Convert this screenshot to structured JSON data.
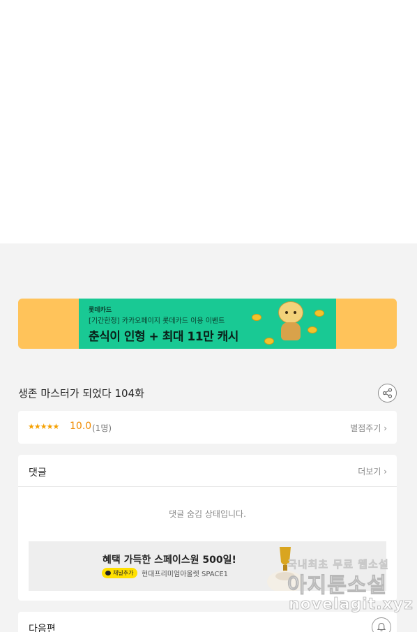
{
  "banner": {
    "brand": "롯데카드",
    "subtitle": "[기간한정] 카카오페이지 롯데카드 이용 이벤트",
    "title": "춘식이 인형 + 최대 11만 캐시",
    "bg_color": "#ffc35a",
    "accent_color": "#19c994"
  },
  "episode": {
    "title": "생존 마스터가 되었다 104화"
  },
  "rating": {
    "stars": "★★★★★",
    "value": "10.0",
    "count": "(1명)",
    "rate_label": "별점주기 ›"
  },
  "comments": {
    "label": "댓글",
    "more_label": "더보기 ›",
    "hidden_message": "댓글 숨김 상태입니다."
  },
  "inner_ad": {
    "title": "혜택 가득한 스페이스원 500일!",
    "badge": "채널추가",
    "subtitle": "현대프리미엄아울렛 SPACE1"
  },
  "next_episode": {
    "label": "다음편"
  },
  "watermark": {
    "line1": "국내최초 무료 웹소설",
    "line2": "아지툰소설",
    "line3": "novelagit.xyz"
  }
}
